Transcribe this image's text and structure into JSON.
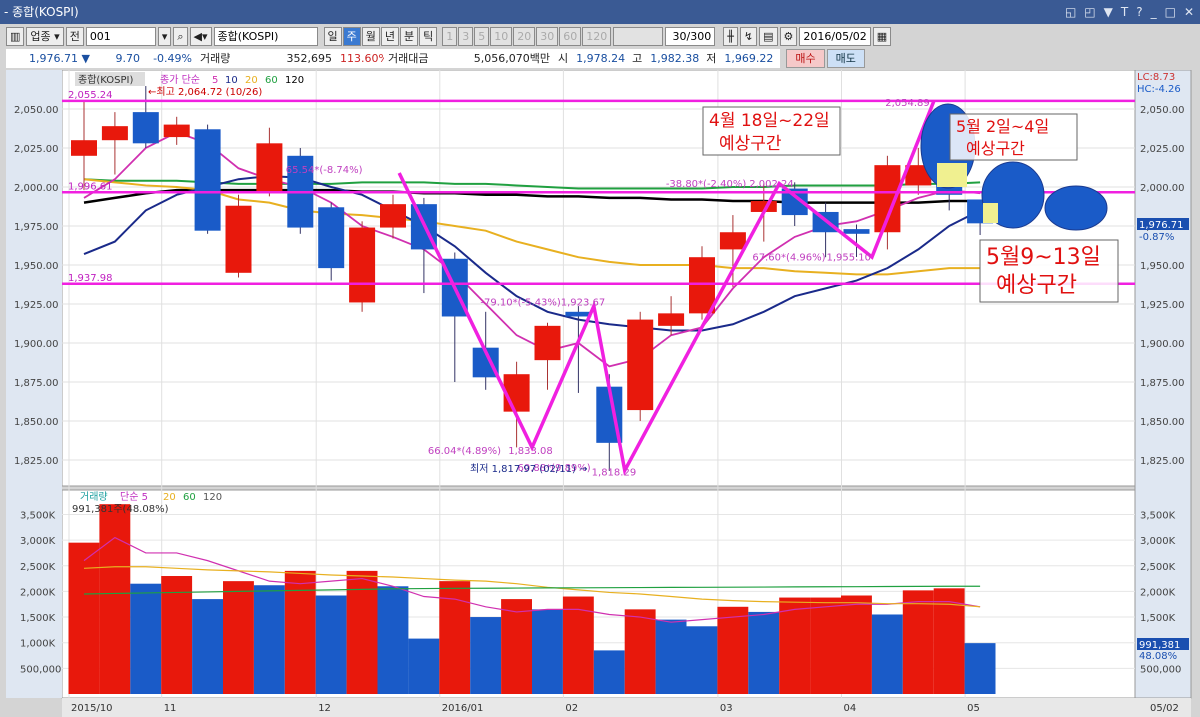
{
  "window": {
    "title": "- 종합(KOSPI)",
    "controls": [
      "◱",
      "◰",
      "▼",
      "T",
      "?",
      "_",
      "□",
      "✕"
    ]
  },
  "toolbar": {
    "market": "업종",
    "prev": "전",
    "code": "001",
    "name": "종합(KOSPI)",
    "periods": [
      {
        "label": "일",
        "active": false
      },
      {
        "label": "주",
        "active": true
      },
      {
        "label": "월",
        "active": false
      },
      {
        "label": "년",
        "active": false
      },
      {
        "label": "분",
        "active": false
      },
      {
        "label": "틱",
        "active": false
      }
    ],
    "intervals": [
      "1",
      "3",
      "5",
      "10",
      "20",
      "30",
      "60",
      "120"
    ],
    "count": "30/300",
    "date": "2016/05/02"
  },
  "quote": {
    "price": "1,976.71 ▼",
    "change": "9.70",
    "change_pct": "-0.49%",
    "volume_label": "거래량",
    "volume": "352,695",
    "volume_pct": "113.60%",
    "amount_label": "거래대금",
    "amount": "5,056,070백만",
    "open_label": "시",
    "open": "1,978.24",
    "high_label": "고",
    "high": "1,982.38",
    "low_label": "저",
    "low": "1,969.22",
    "buy": "매수",
    "sell": "매도"
  },
  "colors": {
    "up": "#e8180c",
    "down": "#1a5bc8",
    "zigzag": "#f020e0",
    "ma5": "#d030b0",
    "ma10": "#1a2a8a",
    "ma20": "#e8b020",
    "ma60": "#20a040",
    "ma120": "#000000"
  },
  "price_panel": {
    "legend_name": "종합(KOSPI)",
    "legend_ma": "종가 단순",
    "ma_periods": [
      "5",
      "10",
      "20",
      "60",
      "120"
    ],
    "lc": "LC:8.73",
    "hc": "HC:-4.26",
    "yticks": [
      "2,050.00",
      "2,025.00",
      "2,000.00",
      "1,975.00",
      "1,950.00",
      "1,925.00",
      "1,900.00",
      "1,875.00",
      "1,850.00",
      "1,825.00"
    ],
    "current_tag": "1,976.71",
    "current_pct": "-0.87%",
    "hlines": [
      {
        "label": "2,055.24",
        "value": 2055.24
      },
      {
        "label": "1,996.61",
        "value": 1996.61
      },
      {
        "label": "1,937.98",
        "value": 1937.98
      }
    ]
  },
  "volume_panel": {
    "legend": "거래량",
    "legend_ma": "단순 5",
    "ma_periods": [
      "20",
      "60",
      "120"
    ],
    "info": "991,381주(48.08%)",
    "yticks": [
      "3,500K",
      "3,000K",
      "2,500K",
      "2,000K",
      "1,500K",
      "1,000K",
      "500,000"
    ],
    "current_tag": "991,381",
    "current_pct": "48.08%"
  },
  "xaxis": [
    {
      "label": "2015/10",
      "i": 0
    },
    {
      "label": "11",
      "i": 3
    },
    {
      "label": "12",
      "i": 8
    },
    {
      "label": "2016/01",
      "i": 12
    },
    {
      "label": "02",
      "i": 16
    },
    {
      "label": "03",
      "i": 21
    },
    {
      "label": "04",
      "i": 25
    },
    {
      "label": "05",
      "i": 29
    }
  ],
  "xaxis_end": "05/02",
  "annotations": {
    "high": "←최고 2,064.72 (10/26)",
    "low": "최저 1,817.97 (02/11) →",
    "labels": [
      {
        "t": "65.54*(-8.74%)",
        "i": 7.5,
        "v": 2009
      },
      {
        "t": "-79.10*(-5.43%)",
        "i": 13.8,
        "v": 1924
      },
      {
        "t": "1,923.67",
        "i": 16.4,
        "v": 1924
      },
      {
        "t": "66.04*(4.89%)",
        "i": 12.1,
        "v": 1829
      },
      {
        "t": "1,833.08",
        "i": 14.7,
        "v": 1829
      },
      {
        "t": "60.88*(9.89%)",
        "i": 15,
        "v": 1818
      },
      {
        "t": "1,818.29",
        "i": 17.4,
        "v": 1815
      },
      {
        "t": "-38.80*(-2.40%)",
        "i": 19.8,
        "v": 2000
      },
      {
        "t": "2,002.24",
        "i": 22.5,
        "v": 2000
      },
      {
        "t": "67.60*(4.96%)",
        "i": 22.6,
        "v": 1953
      },
      {
        "t": "1,955.10",
        "i": 25,
        "v": 1953
      },
      {
        "t": "2,054.89",
        "i": 26.9,
        "v": 2052
      }
    ],
    "boxes": [
      {
        "line1": "4월 18일~22일",
        "line2": "예상구간"
      },
      {
        "line1": "5월  2일~4일",
        "line2": "예상구간"
      },
      {
        "line1": "5월9~13일",
        "line2": "예상구간"
      }
    ]
  },
  "chart_data": {
    "type": "candlestick",
    "candles": [
      [
        2020,
        2055,
        1998,
        2030
      ],
      [
        2030,
        2048,
        2008,
        2039
      ],
      [
        2048,
        2064.72,
        2025,
        2028
      ],
      [
        2032,
        2045,
        2027,
        2040
      ],
      [
        2037,
        2040,
        1970,
        1972
      ],
      [
        1945,
        1995,
        1942,
        1988
      ],
      [
        1996,
        2038,
        1994,
        2028
      ],
      [
        2020,
        2025,
        1970,
        1974
      ],
      [
        1987,
        1990,
        1940,
        1948
      ],
      [
        1926,
        1978,
        1920,
        1974
      ],
      [
        1974,
        1995,
        1967,
        1989
      ],
      [
        1989,
        1993,
        1932,
        1960
      ],
      [
        1954,
        1958,
        1875,
        1917
      ],
      [
        1897,
        1920,
        1870,
        1878
      ],
      [
        1856,
        1888,
        1833.08,
        1880
      ],
      [
        1889,
        1913,
        1870,
        1911
      ],
      [
        1920,
        1923.67,
        1868,
        1917
      ],
      [
        1872,
        1880,
        1817.97,
        1836
      ],
      [
        1857,
        1920,
        1850,
        1915
      ],
      [
        1911,
        1930,
        1905,
        1919
      ],
      [
        1919,
        1962,
        1915,
        1955
      ],
      [
        1960,
        1982,
        1936,
        1971
      ],
      [
        1984,
        2002.24,
        1965,
        1991
      ],
      [
        1999,
        2003,
        1975,
        1982
      ],
      [
        1984,
        1990,
        1955,
        1971
      ],
      [
        1973,
        1976,
        1955.1,
        1970
      ],
      [
        1971,
        2020,
        1960,
        2014
      ],
      [
        2001,
        2025,
        1995,
        2014
      ],
      [
        2005,
        2020,
        1985,
        1995
      ],
      [
        1992,
        1982.38,
        1969.22,
        1976.71
      ]
    ],
    "ma5": [
      1993,
      2005,
      2025,
      2035,
      2028,
      2012,
      2005,
      2000,
      1990,
      1975,
      1968,
      1960,
      1945,
      1925,
      1905,
      1895,
      1900,
      1885,
      1890,
      1905,
      1910,
      1935,
      1955,
      1968,
      1975,
      1978,
      1985,
      1993,
      1998,
      1996
    ],
    "ma10": [
      1957,
      1965,
      1985,
      1995,
      2000,
      2005,
      2007,
      2006,
      2000,
      1995,
      1985,
      1975,
      1962,
      1945,
      1930,
      1920,
      1915,
      1912,
      1910,
      1908,
      1908,
      1912,
      1920,
      1930,
      1935,
      1940,
      1948,
      1960,
      1975,
      1985
    ],
    "ma20": [
      2005,
      2003,
      2001,
      2000,
      1998,
      1992,
      1990,
      1985,
      1983,
      1982,
      1980,
      1978,
      1975,
      1972,
      1965,
      1960,
      1955,
      1952,
      1950,
      1950,
      1950,
      1948,
      1948,
      1946,
      1945,
      1944,
      1944,
      1946,
      1948,
      1948
    ],
    "ma60": [
      2005,
      2004,
      2004,
      2004,
      2003,
      2002,
      2002,
      2002,
      2002,
      2003,
      2003,
      2003,
      2002,
      2002,
      2001,
      2000,
      1999,
      1999,
      1999,
      1999,
      1999,
      2000,
      2000,
      2001,
      2001,
      2001,
      2001,
      2002,
      2002,
      2003
    ],
    "ma120": [
      1990,
      1993,
      1996,
      1998,
      1998,
      1998,
      1998,
      1998,
      1998,
      1997,
      1997,
      1996,
      1996,
      1995,
      1995,
      1994,
      1994,
      1993,
      1993,
      1992,
      1992,
      1991,
      1991,
      1990,
      1990,
      1990,
      1990,
      1990,
      1991,
      1991
    ],
    "zigzag": [
      [
        10.2,
        2009
      ],
      [
        14.5,
        1833.08
      ],
      [
        16.5,
        1923.67
      ],
      [
        17.5,
        1818.29
      ],
      [
        22.5,
        2002.24
      ],
      [
        25.5,
        1955.1
      ],
      [
        27.5,
        2054.89
      ]
    ],
    "volume": [
      2950,
      3700,
      2150,
      2300,
      1850,
      2200,
      2120,
      2400,
      1920,
      2400,
      2100,
      1080,
      2200,
      1500,
      1850,
      1650,
      1900,
      850,
      1650,
      1450,
      1320,
      1700,
      1600,
      1880,
      1880,
      1920,
      1550,
      2020,
      2060,
      991.381
    ],
    "volume_up": [
      1,
      1,
      0,
      1,
      0,
      1,
      0,
      1,
      0,
      1,
      0,
      0,
      1,
      0,
      1,
      0,
      1,
      0,
      1,
      0,
      0,
      1,
      0,
      1,
      1,
      1,
      0,
      1,
      1,
      0
    ],
    "vma5": [
      2600,
      3050,
      2750,
      2750,
      2600,
      2400,
      2200,
      2150,
      2200,
      2250,
      2100,
      1900,
      1850,
      1700,
      1600,
      1650,
      1650,
      1550,
      1500,
      1400,
      1450,
      1500,
      1550,
      1650,
      1700,
      1750,
      1750,
      1800,
      1800,
      1700
    ],
    "vma20": [
      2450,
      2480,
      2480,
      2450,
      2420,
      2400,
      2380,
      2350,
      2320,
      2300,
      2280,
      2250,
      2220,
      2200,
      2150,
      2080,
      2030,
      1980,
      1950,
      1900,
      1850,
      1820,
      1800,
      1790,
      1780,
      1780,
      1760,
      1760,
      1750,
      1700
    ],
    "vma60": [
      1950,
      1960,
      1970,
      1980,
      1990,
      2000,
      2010,
      2020,
      2030,
      2040,
      2050,
      2055,
      2060,
      2062,
      2065,
      2068,
      2070,
      2072,
      2075,
      2078,
      2080,
      2082,
      2085,
      2088,
      2090,
      2092,
      2095,
      2098,
      2100,
      2100
    ],
    "ylim": [
      1810,
      2075
    ],
    "volume_ylim": [
      0,
      3800
    ]
  }
}
